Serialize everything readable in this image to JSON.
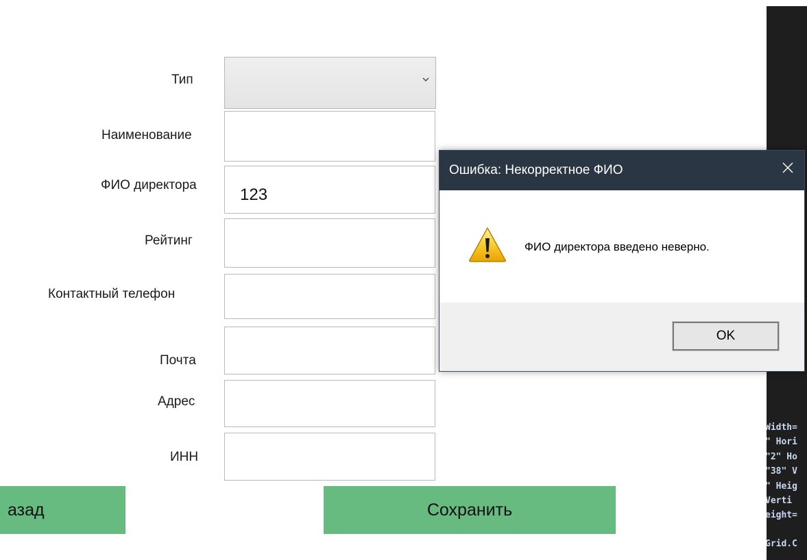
{
  "form": {
    "type_label": "Тип",
    "type_value": "",
    "name_label": "Наименование",
    "name_value": "",
    "director_label": "ФИО директора",
    "director_value": "123",
    "rating_label": "Рейтинг",
    "rating_value": "",
    "phone_label": "Контактный телефон",
    "phone_value": "",
    "email_label": "Почта",
    "email_value": "",
    "address_label": "Адрес",
    "address_value": "",
    "inn_label": "ИНН",
    "inn_value": ""
  },
  "buttons": {
    "back_label": "азад",
    "save_label": "Сохранить",
    "accent_color": "#67bb80"
  },
  "dialog": {
    "title": "Ошибка: Некорректное ФИО",
    "message": "ФИО директора введено неверно.",
    "ok_label": "OK",
    "icon": "warning-icon",
    "titlebar_color": "#2b3645"
  },
  "editor": {
    "lines": [
      "Width=",
      "\" Hori",
      "\"2\" Ho",
      "\"38\" V",
      "\" Heig",
      " Verti",
      "eight=",
      "Grid.C"
    ]
  }
}
